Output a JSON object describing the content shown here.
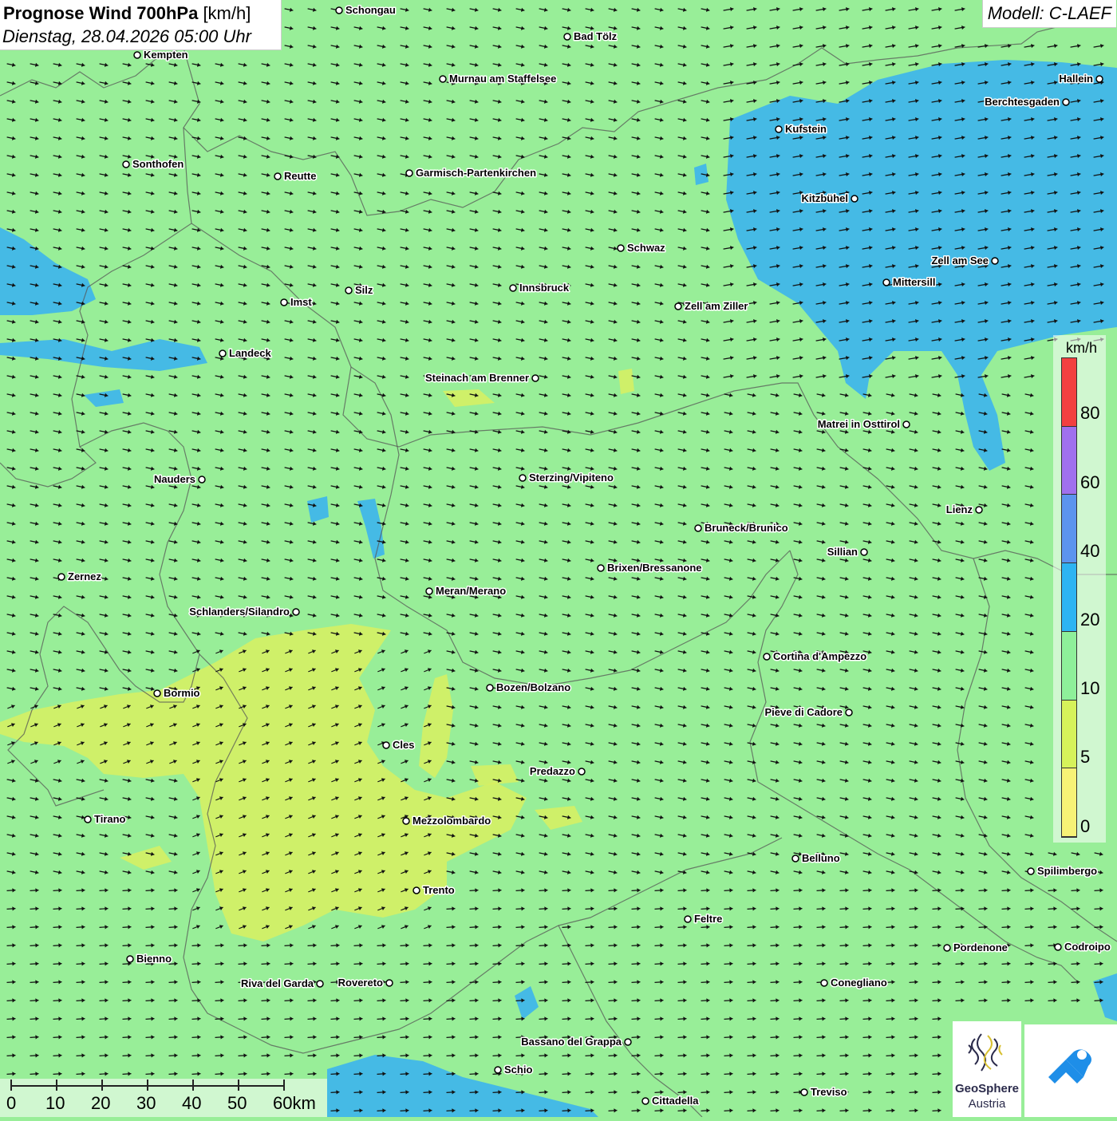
{
  "title": {
    "main": "Prognose Wind 700hPa",
    "unit": "[km/h]",
    "datetime": "Dienstag, 28.04.2026 05:00 Uhr"
  },
  "model": "Modell: C-LAEF",
  "legend": {
    "unit": "km/h",
    "ticks": [
      "80",
      "60",
      "40",
      "20",
      "10",
      "5",
      "0"
    ],
    "colors": [
      "#f24040",
      "#a070ee",
      "#5c94ee",
      "#2db4f2",
      "#8ef09a",
      "#d6f25a",
      "#f6f276"
    ]
  },
  "scale": {
    "labels": [
      "0",
      "10",
      "20",
      "30",
      "40",
      "50",
      "60km"
    ]
  },
  "logo": {
    "name1": "GeoSphere",
    "name2": "Austria"
  },
  "colors": {
    "background": "#98ee98",
    "calm": "#d8f060",
    "moderate": "#36b0f2",
    "arrow": "#111111"
  },
  "cities": [
    {
      "name": "Schongau"
    },
    {
      "name": "Bad Tölz"
    },
    {
      "name": "Kempten"
    },
    {
      "name": "Murnau am Staffelsee"
    },
    {
      "name": "Hallein"
    },
    {
      "name": "Berchtesgaden"
    },
    {
      "name": "Kufstein"
    },
    {
      "name": "Sonthofen"
    },
    {
      "name": "Reutte"
    },
    {
      "name": "Garmisch-Partenkirchen"
    },
    {
      "name": "Kitzbühel"
    },
    {
      "name": "Schwaz"
    },
    {
      "name": "Zell am See"
    },
    {
      "name": "Mittersill"
    },
    {
      "name": "Silz"
    },
    {
      "name": "Innsbruck"
    },
    {
      "name": "Imst"
    },
    {
      "name": "Zell am Ziller"
    },
    {
      "name": "Landeck"
    },
    {
      "name": "Steinach am Brenner"
    },
    {
      "name": "Matrei in Osttirol"
    },
    {
      "name": "Nauders"
    },
    {
      "name": "Sterzing/Vipiteno"
    },
    {
      "name": "Lienz"
    },
    {
      "name": "Bruneck/Brunico"
    },
    {
      "name": "Sillian"
    },
    {
      "name": "Zernez"
    },
    {
      "name": "Brixen/Bressanone"
    },
    {
      "name": "Meran/Merano"
    },
    {
      "name": "Schlanders/Silandro"
    },
    {
      "name": "Cortina d'Ampezzo"
    },
    {
      "name": "Bozen/Bolzano"
    },
    {
      "name": "Bormio"
    },
    {
      "name": "Pieve di Cadore"
    },
    {
      "name": "Cles"
    },
    {
      "name": "Predazzo"
    },
    {
      "name": "Tirano"
    },
    {
      "name": "Mezzolombardo"
    },
    {
      "name": "Belluno"
    },
    {
      "name": "Spilimbergo"
    },
    {
      "name": "Trento"
    },
    {
      "name": "Feltre"
    },
    {
      "name": "Pordenone"
    },
    {
      "name": "Codroipo"
    },
    {
      "name": "Bienno"
    },
    {
      "name": "Riva del Garda"
    },
    {
      "name": "Rovereto"
    },
    {
      "name": "Conegliano"
    },
    {
      "name": "Bassano del Grappa"
    },
    {
      "name": "Schio"
    },
    {
      "name": "Treviso"
    },
    {
      "name": "Cittadella"
    }
  ]
}
